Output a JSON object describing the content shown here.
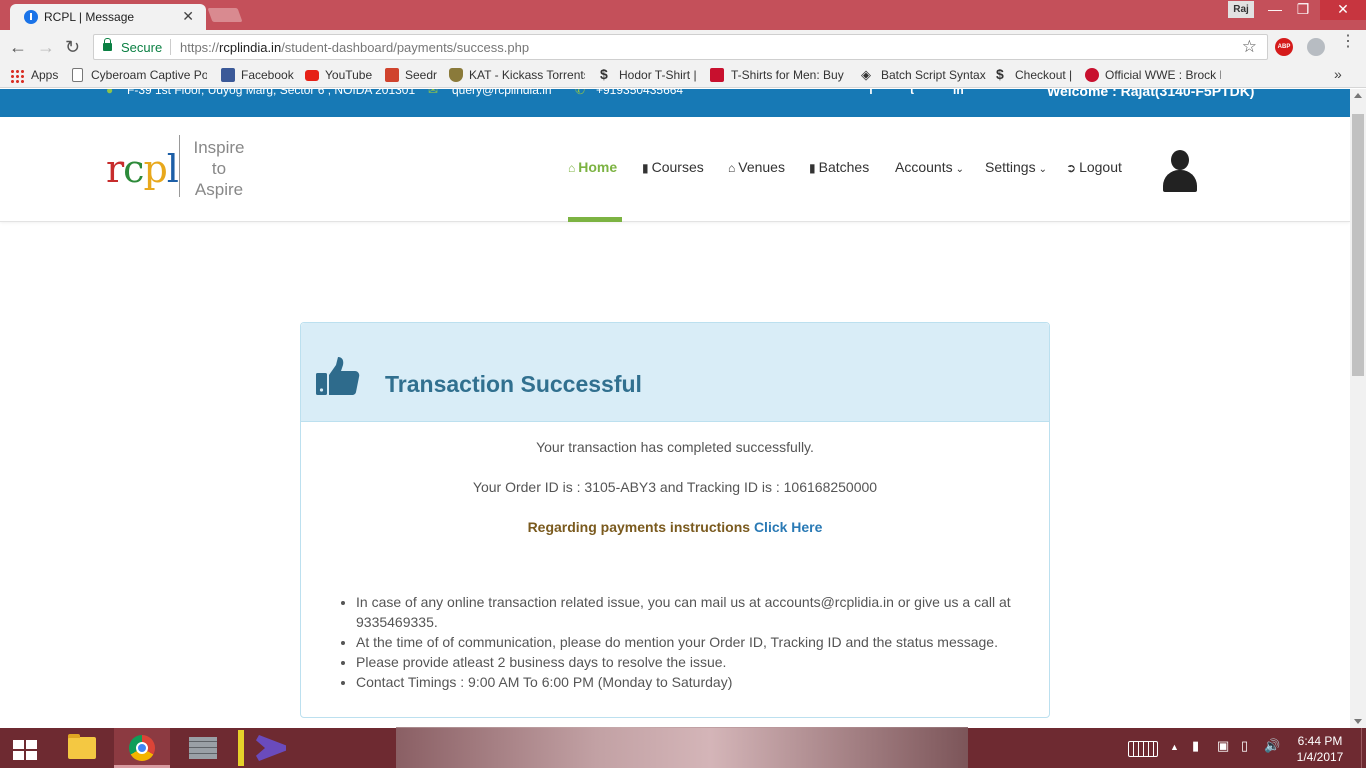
{
  "browser": {
    "tab_title": "RCPL | Message",
    "tab_close": "✕",
    "profile": "Raj",
    "win_min": "—",
    "win_max": "❐",
    "win_close": "✕",
    "secure_label": "Secure",
    "url_scheme": "https://",
    "url_host": "rcplindia.in",
    "url_path": "/student-dashboard/payments/success.php",
    "abp_label": "ABP",
    "bookmarks": [
      {
        "label": "Apps"
      },
      {
        "label": "Cyberoam Captive Po"
      },
      {
        "label": "Facebook"
      },
      {
        "label": "YouTube"
      },
      {
        "label": "Seedr"
      },
      {
        "label": "KAT - Kickass Torrents"
      },
      {
        "label": "Hodor T-Shirt |"
      },
      {
        "label": "T-Shirts for Men: Buy"
      },
      {
        "label": "Batch Script Syntax"
      },
      {
        "label": "Checkout |"
      },
      {
        "label": "Official WWE : Brock L"
      }
    ],
    "bookmarks_more": "»"
  },
  "site": {
    "topbar": {
      "address": "F-39 1st Floor, Udyog Marg, Sector 6 , NOIDA 201301",
      "email": "query@rcplindia.in",
      "phone": "+919350435664",
      "social": [
        "f",
        "t",
        "in"
      ],
      "welcome": "Welcome : Rajat(3140-F5PTDK)"
    },
    "logo": {
      "r": "r",
      "c": "c",
      "p": "p",
      "l": "l",
      "tagline": [
        "Inspire",
        "to",
        "Aspire"
      ]
    },
    "nav": [
      {
        "label": "Home",
        "icon": "home-icon",
        "active": true
      },
      {
        "label": "Courses",
        "icon": "book-icon"
      },
      {
        "label": "Venues",
        "icon": "home-icon"
      },
      {
        "label": "Batches",
        "icon": "book-icon"
      },
      {
        "label": "Accounts",
        "icon": "chevron-down-icon"
      },
      {
        "label": "Settings",
        "icon": "chevron-down-icon"
      },
      {
        "label": "Logout",
        "icon": "sign-out-icon"
      }
    ],
    "accent_color": "#7cb342",
    "topbar_color": "#1779b5"
  },
  "panel": {
    "title": "Transaction Successful",
    "message": "Your transaction has completed successfully.",
    "order_line": "Your Order ID is : 3105-ABY3 and Tracking ID is : 106168250000",
    "payment_instructions": "Regarding payments instructions",
    "click_here": "Click Here",
    "notes": [
      "In case of any online transaction related issue, you can mail us at accounts@rcplidia.in or give us a call at 9335469335.",
      "At the time of of communication, please do mention your Order ID, Tracking ID and the status message.",
      "Please provide atleast 2 business days to resolve the issue.",
      "Contact Timings : 9:00 AM To 6:00 PM (Monday to Saturday)"
    ]
  },
  "taskbar": {
    "time": "6:44 PM",
    "date": "1/4/2017",
    "tray_up": "▲"
  }
}
